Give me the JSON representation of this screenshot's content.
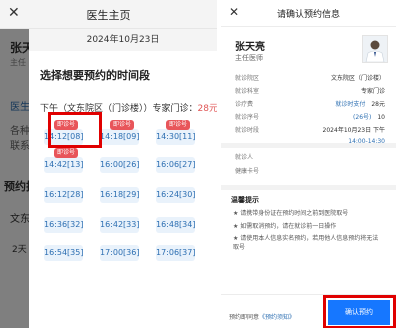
{
  "left": {
    "nav_title": "医生主页",
    "background": {
      "doctor_name": "张天",
      "doctor_title": "主任",
      "desc_1": "医生介",
      "desc_2": "各种",
      "desc_3": "联系",
      "section": "预约挂",
      "cell_1": "文东",
      "cell_2": "2天"
    },
    "sheet": {
      "date": "2024年10月23日",
      "title": "选择想要预约的时间段",
      "session_label": "下午（文东院区（门诊楼））专家门诊：",
      "session_fee": "28元",
      "tag_label": "即诊号",
      "slots": [
        {
          "label": "14:12[08]",
          "tagged": true
        },
        {
          "label": "14:18[09]",
          "tagged": true
        },
        {
          "label": "14:30[11]",
          "tagged": true
        },
        {
          "label": "14:42[13]",
          "tagged": true
        },
        {
          "label": "16:00[26]",
          "tagged": false
        },
        {
          "label": "16:06[27]",
          "tagged": false
        },
        {
          "label": "16:12[28]",
          "tagged": false
        },
        {
          "label": "16:18[29]",
          "tagged": false
        },
        {
          "label": "16:24[30]",
          "tagged": false
        },
        {
          "label": "16:36[32]",
          "tagged": false
        },
        {
          "label": "16:42[33]",
          "tagged": false
        },
        {
          "label": "16:48[34]",
          "tagged": false
        },
        {
          "label": "16:54[35]",
          "tagged": false
        },
        {
          "label": "17:00[36]",
          "tagged": false
        },
        {
          "label": "17:06[37]",
          "tagged": false
        }
      ]
    }
  },
  "right": {
    "nav_title": "请确认预约信息",
    "doctor_name": "张天亮",
    "doctor_title": "主任医师",
    "info_rows": [
      {
        "label": "就诊院区",
        "value": "文东院区（门诊楼）"
      },
      {
        "label": "就诊科室",
        "value": "专家门诊"
      },
      {
        "label": "诊疗费",
        "value": "28元",
        "extra": "就诊时支付"
      },
      {
        "label": "就诊序号",
        "value": "10",
        "extra": "(26号)"
      },
      {
        "label": "就诊时段",
        "value": "2024年10月23日  下午",
        "extra": "14:00-14:30"
      }
    ],
    "patient_label": "就诊人",
    "card_label": "健康卡号",
    "notice_title": "温馨提示",
    "notices": [
      "请携带身份证在预约时间之前到医院取号",
      "如需取消预约，请在就诊前一日操作",
      "请使用本人信息实名预约，若用他人信息预约将无法取号"
    ],
    "agree_text": "预约即同意",
    "agree_link": "《预约须知》",
    "confirm_label": "确认预约"
  }
}
